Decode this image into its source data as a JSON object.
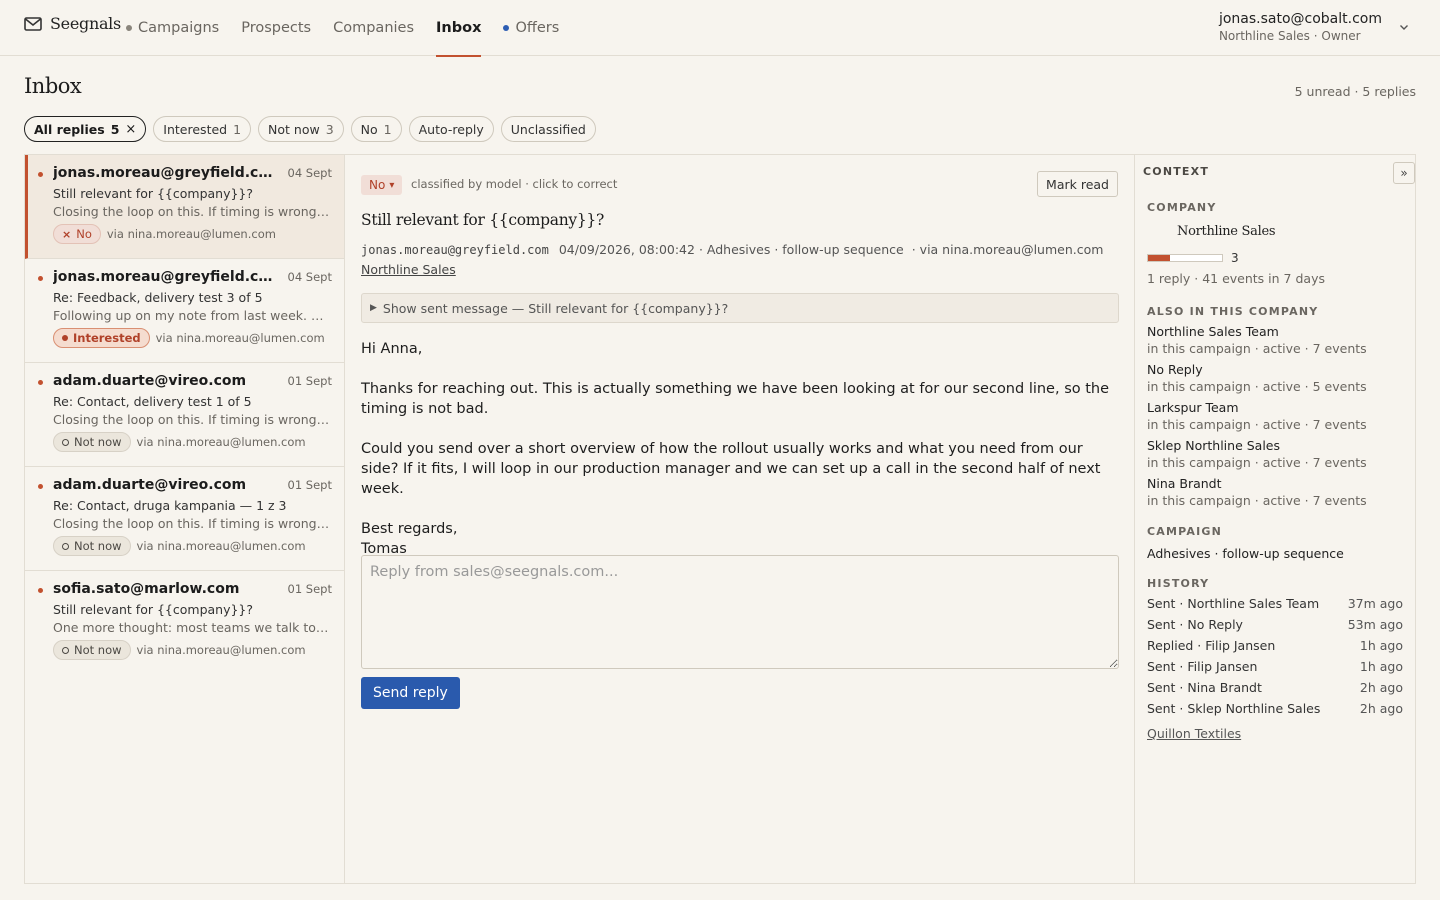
{
  "app": {
    "brand": "Seegnals",
    "nav": [
      {
        "label": "Campaigns",
        "dot": "gray"
      },
      {
        "label": "Prospects"
      },
      {
        "label": "Companies"
      },
      {
        "label": "Inbox",
        "active": true
      },
      {
        "label": "Offers",
        "dot": "blue"
      }
    ],
    "account": {
      "email": "jonas.sato@cobalt.com",
      "sub": "Northline Sales · Owner"
    }
  },
  "page": {
    "title": "Inbox",
    "stats": "5 unread · 5 replies"
  },
  "filters": [
    {
      "label": "All replies",
      "count": "5",
      "active": true,
      "close": "×"
    },
    {
      "label": "Interested",
      "count": "1"
    },
    {
      "label": "Not now",
      "count": "3"
    },
    {
      "label": "No",
      "count": "1"
    },
    {
      "label": "Auto-reply",
      "count": ""
    },
    {
      "label": "Unclassified",
      "count": ""
    }
  ],
  "threads": [
    {
      "from": "jonas.moreau@greyfield.com",
      "date": "04 Sept",
      "subject": "Still relevant for {{company}}?",
      "preview": "Closing the loop on this. If timing is wrong, happy to pause.",
      "badge": "No",
      "badge_type": "no",
      "via": "via nina.moreau@lumen.com",
      "selected": true
    },
    {
      "from": "jonas.moreau@greyfield.com",
      "date": "04 Sept",
      "subject": "Re: Feedback, delivery test 3 of 5",
      "preview": "Following up on my note from last week. Happy to share more.",
      "badge": "Interested",
      "badge_type": "interested",
      "via": "via nina.moreau@lumen.com"
    },
    {
      "from": "adam.duarte@vireo.com",
      "date": "01 Sept",
      "subject": "Re: Contact, delivery test 1 of 5",
      "preview": "Closing the loop on this. If timing is wrong, happy to pause.",
      "badge": "Not now",
      "badge_type": "notnow",
      "via": "via nina.moreau@lumen.com"
    },
    {
      "from": "adam.duarte@vireo.com",
      "date": "01 Sept",
      "subject": "Re: Contact, druga kampania — 1 z 3",
      "preview": "Closing the loop on this. If timing is wrong, happy to pause.",
      "badge": "Not now",
      "badge_type": "notnow",
      "via": "via nina.moreau@lumen.com"
    },
    {
      "from": "sofia.sato@marlow.com",
      "date": "01 Sept",
      "subject": "Still relevant for {{company}}?",
      "preview": "One more thought: most teams we talk to start small.",
      "badge": "Not now",
      "badge_type": "notnow",
      "via": "via nina.moreau@lumen.com"
    }
  ],
  "message": {
    "classification": "No",
    "classification_caret": "▾",
    "classification_note": "classified by model · click to correct",
    "mark_read": "Mark read",
    "subject": "Still relevant for {{company}}?",
    "from": "jonas.moreau@greyfield.com",
    "datetime": "04/09/2026, 08:00:42",
    "campaign": " · Adhesives · follow-up sequence",
    "via": " · via nina.moreau@lumen.com",
    "company": "Northline Sales",
    "sent_toggle": "Show sent message — Still relevant for {{company}}?",
    "body": [
      "Hi Anna,",
      "Thanks for reaching out. This is actually something we have been looking at for our second line, so the timing is not bad.",
      "Could you send over a short overview of how the rollout usually works and what you need from our side? If it fits, I will loop in our production manager and we can set up a call in the second half of next week.",
      "Best regards,\nTomas"
    ],
    "reply_placeholder": "Reply from sales@seegnals.com...",
    "send_label": "Send reply"
  },
  "context": {
    "title": "CONTEXT",
    "collapse": "»",
    "company_label": "COMPANY",
    "company_name": "Northline Sales",
    "score": 3,
    "score_max": 10,
    "summary": "1 reply · 41 events in 7 days",
    "also_label": "ALSO IN THIS COMPANY",
    "also": [
      {
        "name": "Northline Sales Team",
        "sub": "in this campaign · active · 7 events"
      },
      {
        "name": "No Reply",
        "sub": "in this campaign · active · 5 events"
      },
      {
        "name": "Larkspur Team",
        "sub": "in this campaign · active · 7 events"
      },
      {
        "name": "Sklep Northline Sales",
        "sub": "in this campaign · active · 7 events"
      },
      {
        "name": "Nina Brandt",
        "sub": "in this campaign · active · 7 events"
      }
    ],
    "campaign_label": "CAMPAIGN",
    "campaign": "Adhesives · follow-up sequence",
    "history_label": "HISTORY",
    "history": [
      {
        "action": "Sent · Northline Sales Team",
        "time": "37m ago"
      },
      {
        "action": "Sent · No Reply",
        "time": "53m ago"
      },
      {
        "action": "Replied · Filip Jansen",
        "time": "1h ago"
      },
      {
        "action": "Sent · Filip Jansen",
        "time": "1h ago"
      },
      {
        "action": "Sent · Nina Brandt",
        "time": "2h ago"
      },
      {
        "action": "Sent · Sklep Northline Sales",
        "time": "2h ago"
      }
    ],
    "history_link": "Quillon Textiles"
  },
  "colors": {
    "accent": "#c2512f",
    "primary": "#2a5aad",
    "background": "#f7f4ee"
  }
}
